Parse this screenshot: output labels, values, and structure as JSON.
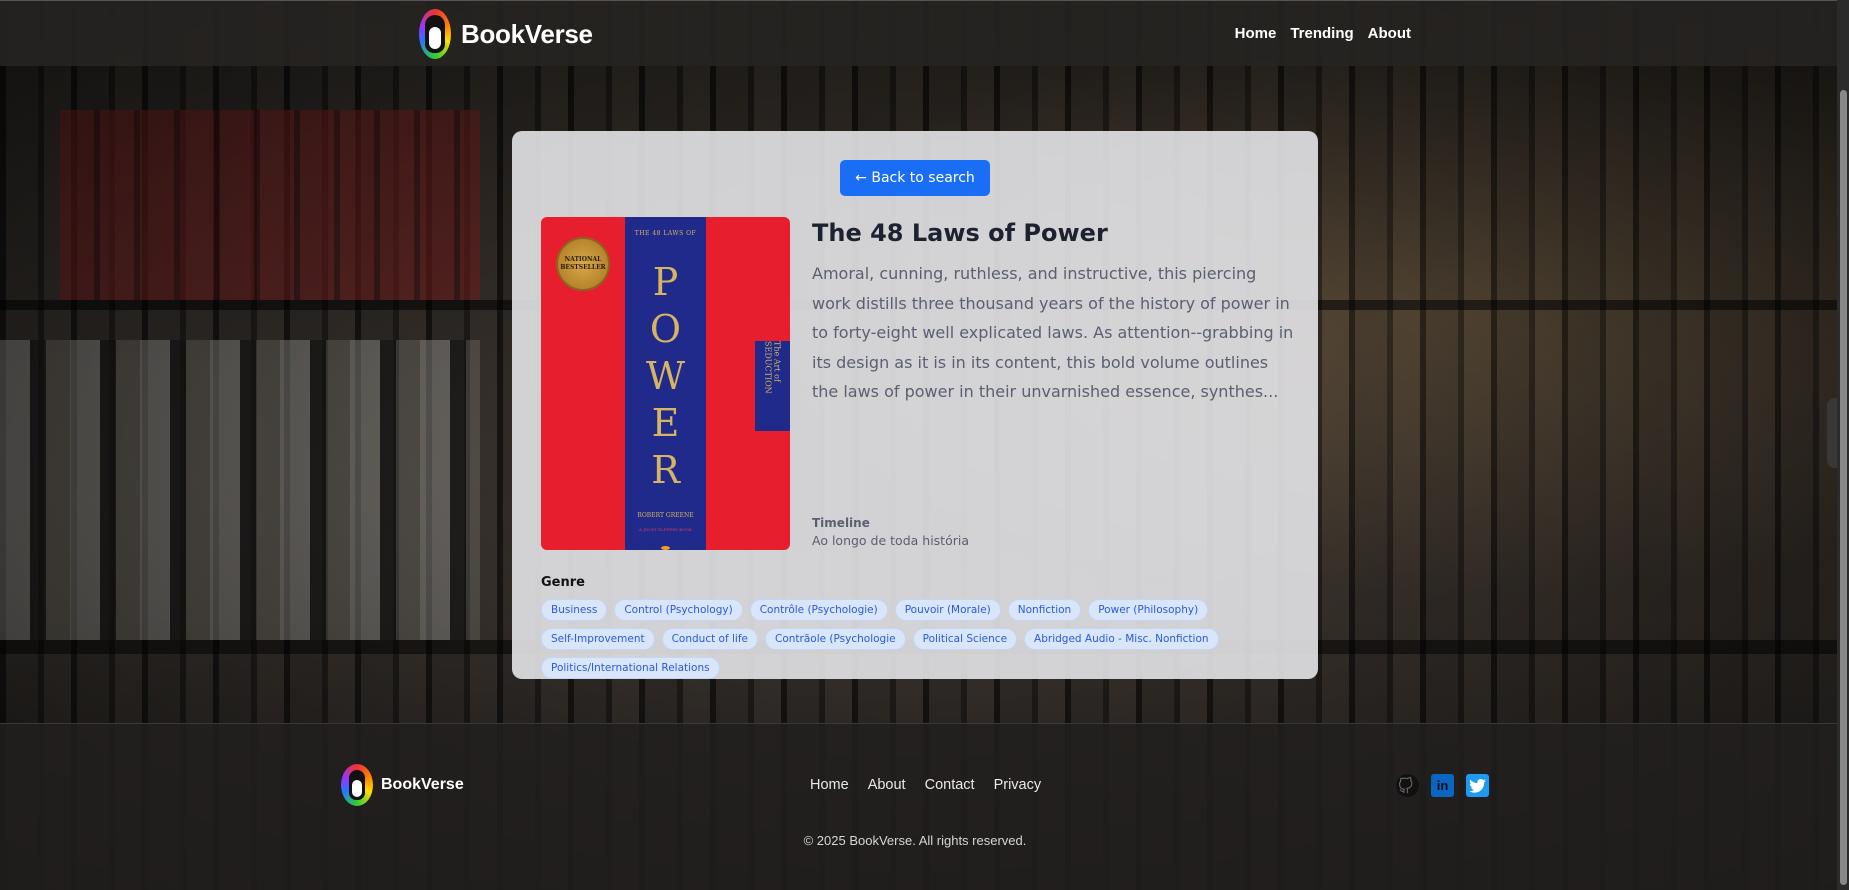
{
  "header": {
    "brand": "BookVerse",
    "nav": [
      "Home",
      "Trending",
      "About"
    ]
  },
  "book": {
    "back_label": "← Back to search",
    "title": "The 48 Laws of Power",
    "description": "Amoral, cunning, ruthless, and instructive, this piercing work distills three thousand years of the history of power in to forty-eight well explicated laws. As attention--grabbing in its design as it is in its content, this bold volume outlines the laws of power in their unvarnished essence, synthes...",
    "timeline_label": "Timeline",
    "timeline_value": "Ao longo de toda história",
    "cover": {
      "top_text": "THE 48 LAWS OF",
      "big_text": "POWER",
      "author": "ROBERT GREENE",
      "subtitle": "A JOOST ELFFERS BOOK",
      "badge": "NATIONAL BESTSELLER",
      "side_text": "The Art of SEDUCTION"
    },
    "genre_label": "Genre",
    "genres": [
      "Business",
      "Control (Psychology)",
      "Contrôle (Psychologie)",
      "Pouvoir (Morale)",
      "Nonfiction",
      "Power (Philosophy)",
      "Self-Improvement",
      "Conduct of life",
      "Contrãole (Psychologie",
      "Political Science",
      "Abridged Audio - Misc. Nonfiction",
      "Politics/International Relations"
    ]
  },
  "footer": {
    "brand": "BookVerse",
    "links": [
      "Home",
      "About",
      "Contact",
      "Privacy"
    ],
    "social": [
      "github-icon",
      "linkedin-icon",
      "twitter-icon"
    ],
    "copyright": "© 2025 BookVerse. All rights reserved."
  },
  "colors": {
    "accent": "#1a6ef5",
    "tag_text": "#2a5bd7",
    "tag_bg": "#d9e6fa",
    "cover_red": "#e71e2e",
    "cover_blue": "#1f2a8a"
  }
}
